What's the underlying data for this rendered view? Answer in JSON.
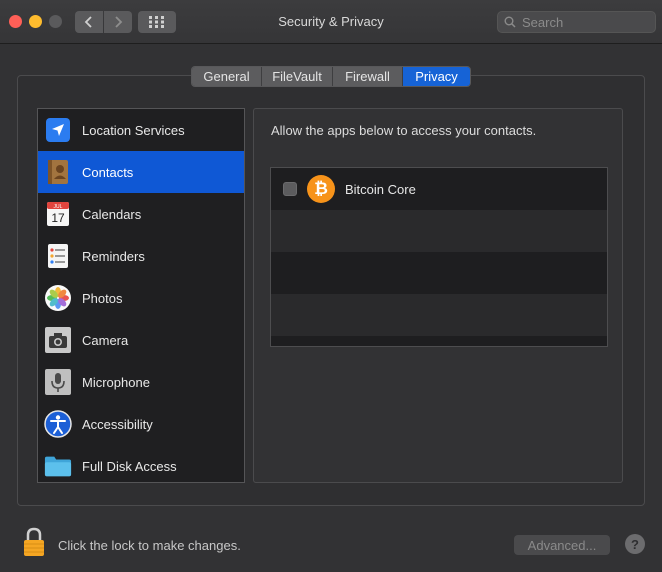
{
  "window": {
    "title": "Security & Privacy"
  },
  "search": {
    "placeholder": "Search"
  },
  "tabs": [
    {
      "label": "General"
    },
    {
      "label": "FileVault"
    },
    {
      "label": "Firewall"
    },
    {
      "label": "Privacy",
      "active": true
    }
  ],
  "sidebar": {
    "items": [
      {
        "label": "Location Services",
        "icon": "location-arrow-icon"
      },
      {
        "label": "Contacts",
        "icon": "contacts-book-icon",
        "selected": true
      },
      {
        "label": "Calendars",
        "icon": "calendar-icon",
        "icon_text_month": "JUL",
        "icon_text_day": "17"
      },
      {
        "label": "Reminders",
        "icon": "reminders-list-icon"
      },
      {
        "label": "Photos",
        "icon": "photos-flower-icon"
      },
      {
        "label": "Camera",
        "icon": "camera-icon"
      },
      {
        "label": "Microphone",
        "icon": "microphone-icon"
      },
      {
        "label": "Accessibility",
        "icon": "accessibility-icon"
      },
      {
        "label": "Full Disk Access",
        "icon": "folder-icon"
      }
    ]
  },
  "main": {
    "description": "Allow the apps below to access your contacts.",
    "apps": [
      {
        "name": "Bitcoin Core",
        "checked": false,
        "icon": "bitcoin-icon",
        "icon_glyph": "₿"
      }
    ]
  },
  "footer": {
    "lock_text": "Click the lock to make changes.",
    "advanced_label": "Advanced...",
    "help_label": "?"
  },
  "colors": {
    "accent": "#1663d6",
    "selection": "#0f58d5",
    "bitcoin": "#f7931a",
    "lock": "#f5a623"
  }
}
